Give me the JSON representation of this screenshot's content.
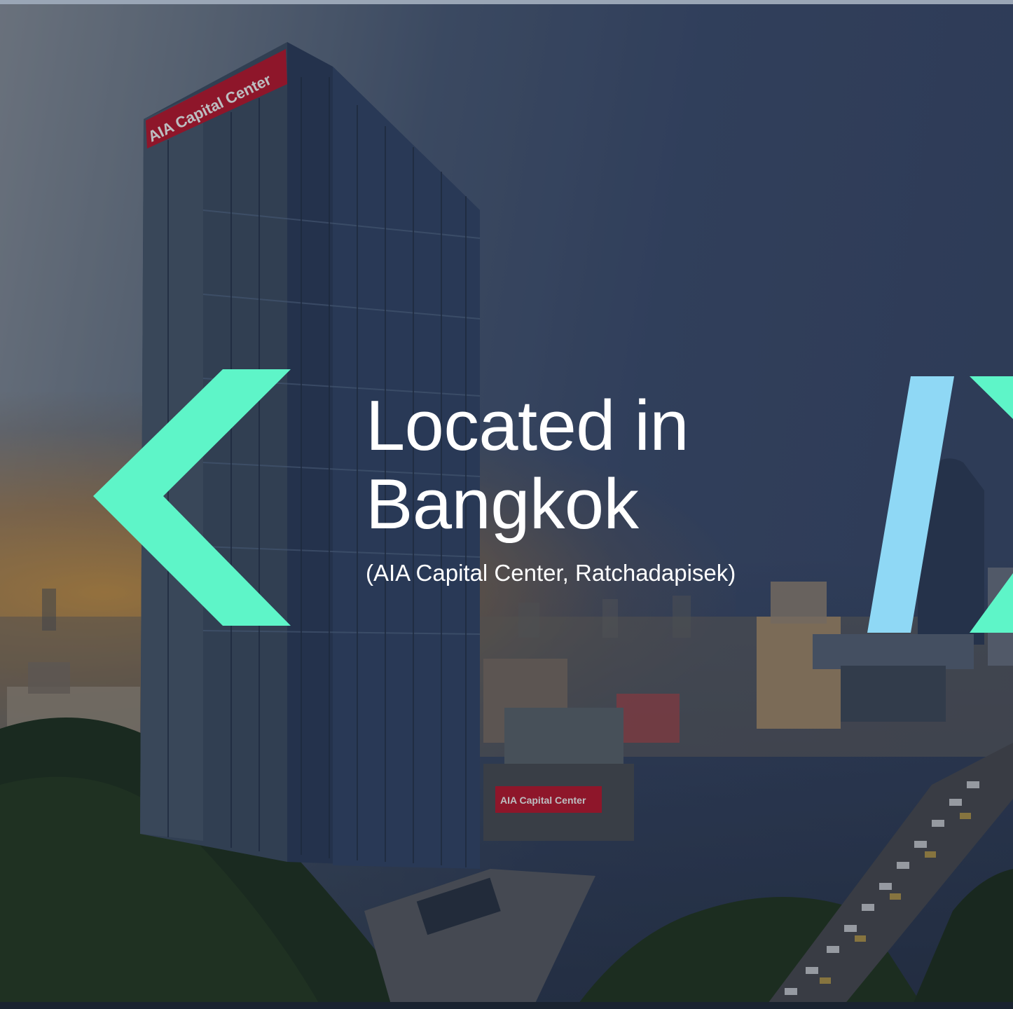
{
  "slide": {
    "headline_line1": "Located in",
    "headline_line2": "Bangkok",
    "subtitle": "(AIA Capital Center, Ratchadapisek)"
  },
  "photo": {
    "building_sign": "AIA Capital Center",
    "podium_sign": "AIA Capital Center"
  },
  "colors": {
    "left_chevron": "#5ef5c8",
    "right_slash": "#8fd8f5",
    "right_chevron": "#5ef5c8",
    "text": "#ffffff",
    "sign_red": "#c0172e"
  },
  "icons": {
    "left": "chevron-left-icon",
    "right_slash": "slash-icon",
    "right": "chevron-right-icon"
  }
}
